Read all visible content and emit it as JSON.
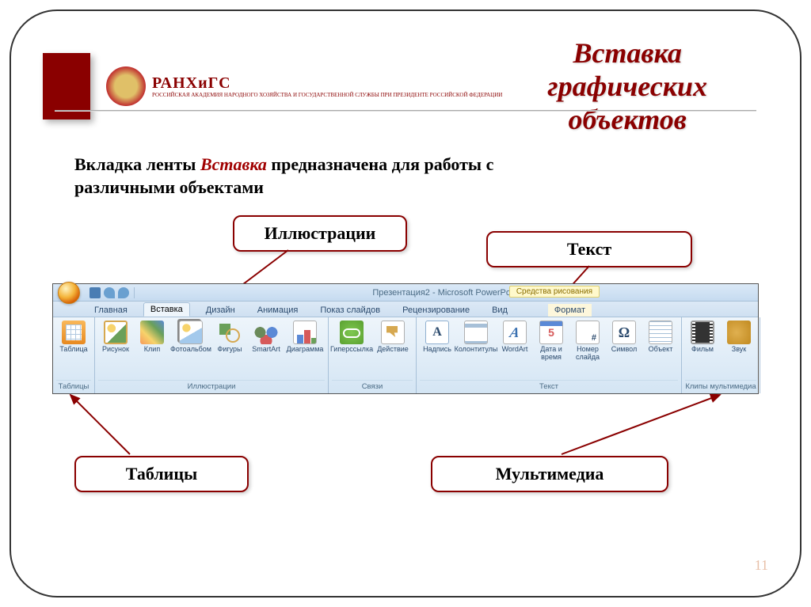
{
  "title": "Вставка графических объектов",
  "logo": {
    "name": "РАНХиГС",
    "subtitle": "РОССИЙСКАЯ АКАДЕМИЯ НАРОДНОГО ХОЗЯЙСТВА И ГОСУДАРСТВЕННОЙ СЛУЖБЫ ПРИ ПРЕЗИДЕНТЕ РОССИЙСКОЙ ФЕДЕРАЦИИ"
  },
  "body": {
    "part1": "Вкладка ленты ",
    "hl": "Вставка",
    "part2": " предназначена для работы  с различными объектами"
  },
  "callouts": {
    "illustrations": "Иллюстрации",
    "text": "Текст",
    "tables": "Таблицы",
    "multimedia": "Мультимедиа"
  },
  "ribbon": {
    "window_title": "Презентация2 - Microsoft PowerPoint",
    "tool_tab_label": "Средства рисования",
    "tabs": {
      "home": "Главная",
      "insert": "Вставка",
      "design": "Дизайн",
      "animations": "Анимация",
      "slideshow": "Показ слайдов",
      "review": "Рецензирование",
      "view": "Вид",
      "format": "Формат"
    },
    "groups": {
      "tables": {
        "label": "Таблицы",
        "btn_table": "Таблица"
      },
      "illustrations": {
        "label": "Иллюстрации",
        "btn_picture": "Рисунок",
        "btn_clip": "Клип",
        "btn_album": "Фотоальбом",
        "btn_shapes": "Фигуры",
        "btn_smartart": "SmartArt",
        "btn_chart": "Диаграмма"
      },
      "links": {
        "label": "Связи",
        "btn_hyperlink": "Гиперссылка",
        "btn_action": "Действие"
      },
      "text": {
        "label": "Текст",
        "btn_textbox": "Надпись",
        "btn_headerfooter": "Колонтитулы",
        "btn_wordart": "WordArt",
        "btn_datetime": "Дата и время",
        "btn_slidenum": "Номер слайда",
        "btn_symbol": "Символ",
        "btn_object": "Объект"
      },
      "media": {
        "label": "Клипы мультимедиа",
        "btn_movie": "Фильм",
        "btn_sound": "Звук"
      }
    }
  },
  "page_number": "11"
}
